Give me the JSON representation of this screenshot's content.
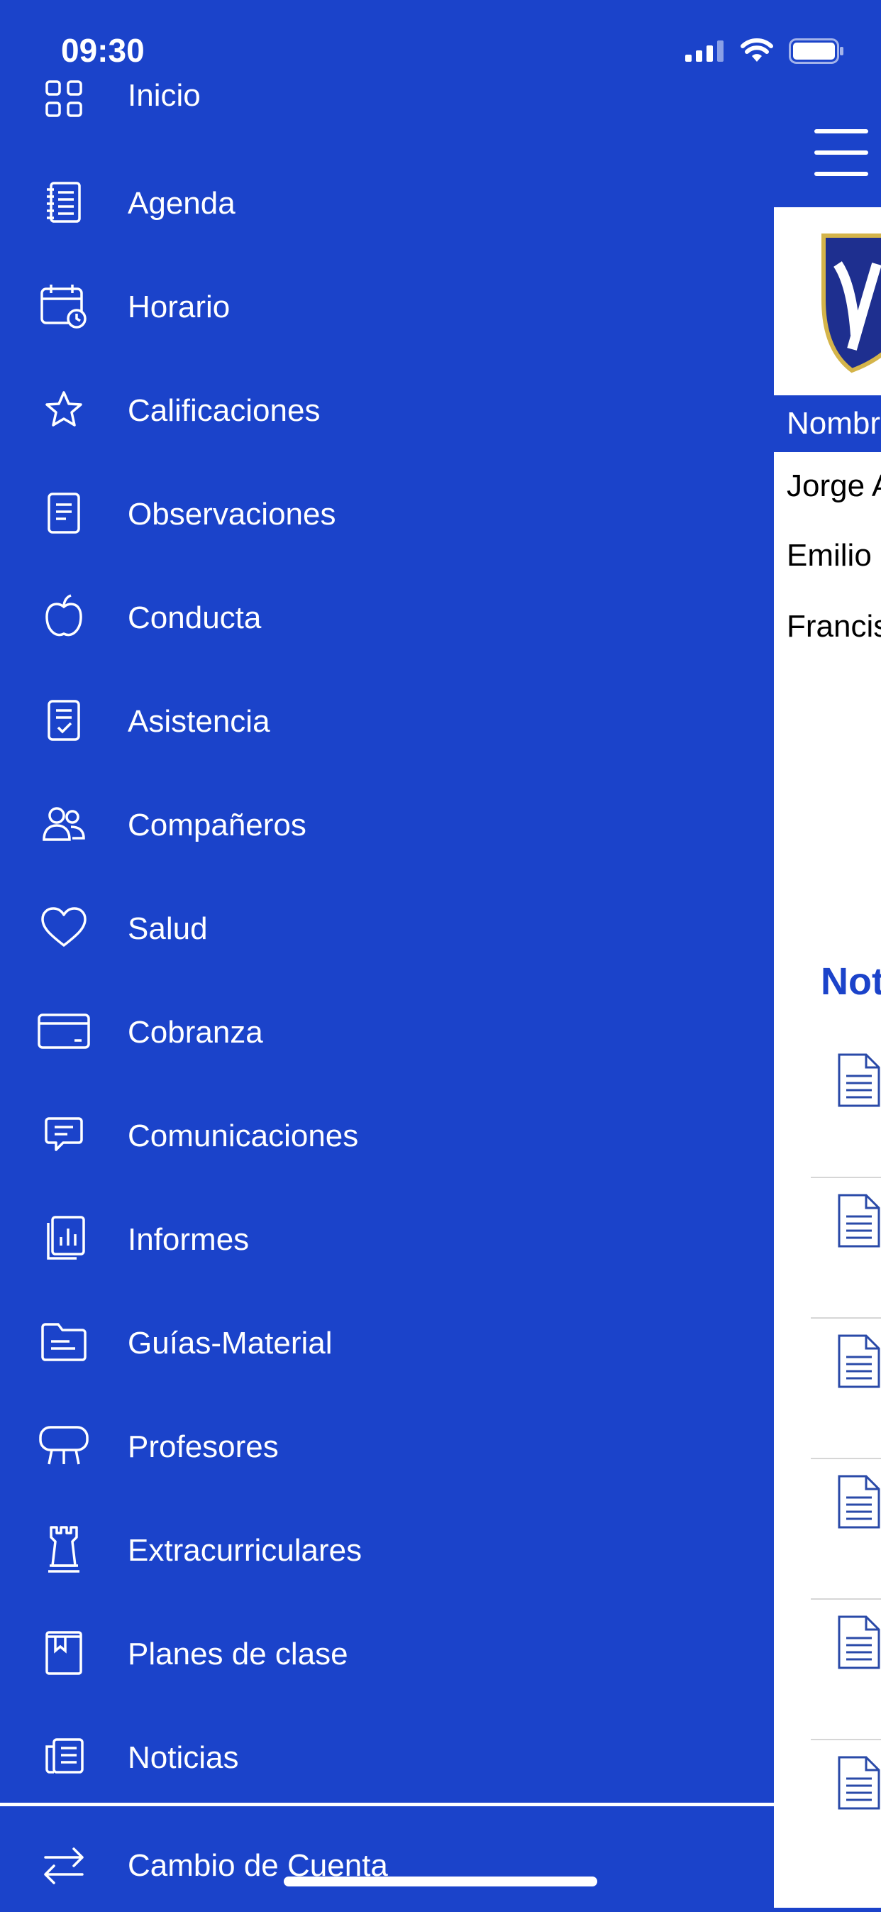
{
  "status_bar": {
    "time": "09:30"
  },
  "menu": {
    "items": [
      {
        "label": "Inicio",
        "icon": "grid-icon"
      },
      {
        "label": "Agenda",
        "icon": "notebook-icon"
      },
      {
        "label": "Horario",
        "icon": "calendar-clock-icon"
      },
      {
        "label": "Calificaciones",
        "icon": "star-icon"
      },
      {
        "label": "Observaciones",
        "icon": "document-icon"
      },
      {
        "label": "Conducta",
        "icon": "apple-icon"
      },
      {
        "label": "Asistencia",
        "icon": "checklist-icon"
      },
      {
        "label": "Compañeros",
        "icon": "people-icon"
      },
      {
        "label": "Salud",
        "icon": "heart-icon"
      },
      {
        "label": "Cobranza",
        "icon": "credit-card-icon"
      },
      {
        "label": "Comunicaciones",
        "icon": "message-icon"
      },
      {
        "label": "Informes",
        "icon": "report-chart-icon"
      },
      {
        "label": "Guías-Material",
        "icon": "folder-icon"
      },
      {
        "label": "Profesores",
        "icon": "board-icon"
      },
      {
        "label": "Extracurriculares",
        "icon": "rook-icon"
      },
      {
        "label": "Planes de clase",
        "icon": "bookmark-book-icon"
      },
      {
        "label": "Noticias",
        "icon": "newspaper-icon"
      }
    ],
    "switch_account": {
      "label": "Cambio de Cuenta",
      "icon": "swap-arrows-icon"
    }
  },
  "main": {
    "table_header": "Nombr",
    "students": [
      "Jorge A",
      "Emilio",
      "Francis"
    ],
    "news_title": "Not",
    "news_count": 6
  },
  "colors": {
    "primary": "#1b43ca",
    "white": "#ffffff",
    "icon_blue": "#2a4aa8"
  }
}
